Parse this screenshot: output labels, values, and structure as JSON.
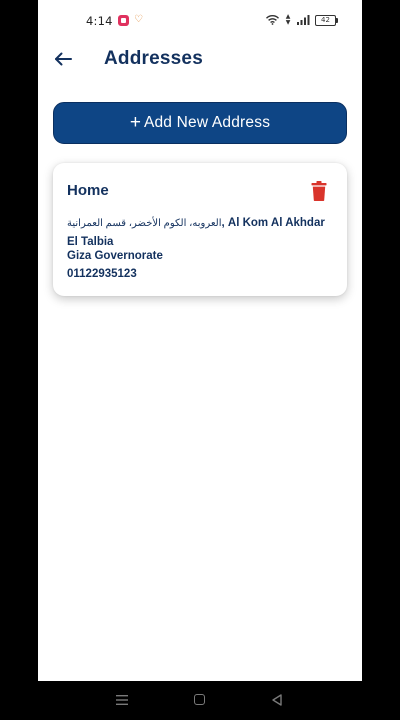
{
  "status_bar": {
    "time": "4:14",
    "battery": "42"
  },
  "header": {
    "title": "Addresses"
  },
  "add_button": {
    "plus": "+",
    "label": "Add New Address"
  },
  "addresses": [
    {
      "title": "Home",
      "address_arabic": "العروبه، الكوم الأخضر، قسم العمرانية",
      "address_latin": ", Al Kom Al Akhdar El Talbia",
      "governorate": "Giza Governorate",
      "phone": "01122935123"
    }
  ],
  "colors": {
    "primary": "#0e4585",
    "title_text": "#13315e",
    "delete": "#d9342b"
  },
  "icons": {
    "back": "arrow-left-icon",
    "delete": "trash-icon"
  }
}
